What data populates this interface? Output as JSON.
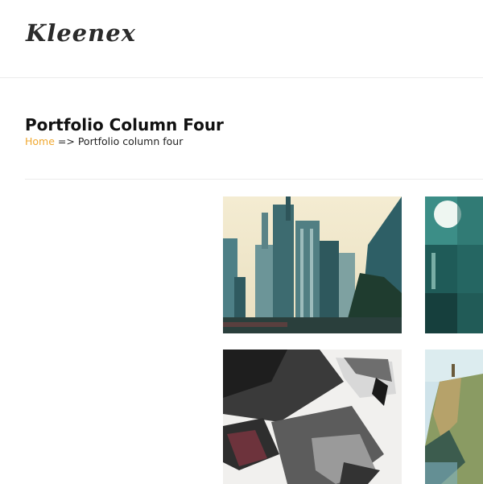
{
  "site": {
    "logo": "Kleenex"
  },
  "page": {
    "title": "Portfolio Column Four"
  },
  "breadcrumb": {
    "home": "Home",
    "separator": "=>",
    "current": "Portfolio column four"
  },
  "colors": {
    "accent": "#f0a830",
    "divider": "#ececec",
    "text": "#222222"
  },
  "portfolio": {
    "items": [
      {
        "subject": "city towers photo"
      },
      {
        "subject": "teal interior photo"
      },
      {
        "subject": "eagle illustration"
      },
      {
        "subject": "cliff landscape illustration"
      }
    ]
  }
}
